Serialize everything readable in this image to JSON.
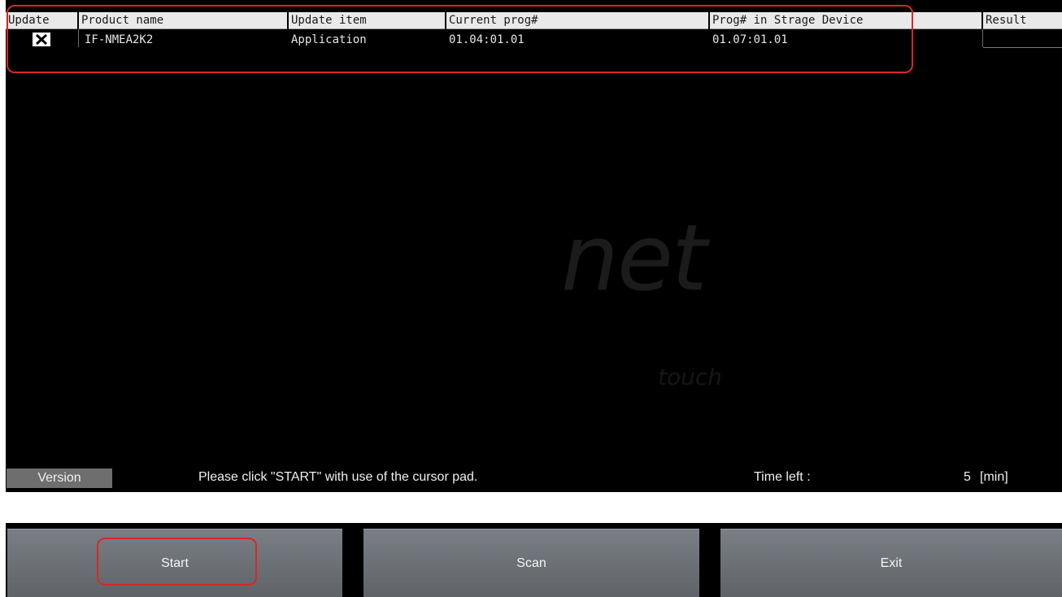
{
  "table": {
    "headers": [
      "Update",
      "Product name",
      "Update item",
      "Current prog#",
      "Prog# in Strage Device",
      "Result"
    ],
    "rows": [
      {
        "update_checked": true,
        "product_name": "IF-NMEA2K2",
        "update_item": "Application",
        "current_prog": "01.04:01.01",
        "storage_prog": "01.07:01.01",
        "result": ""
      }
    ]
  },
  "logo": {
    "main": "net",
    "sub": "touch"
  },
  "status": {
    "version_label": "Version",
    "message": "Please click \"START\" with use of the cursor pad.",
    "time_left_label": "Time left :",
    "time_left_value": "5",
    "time_left_unit": "[min]"
  },
  "message_field": {
    "value": ""
  },
  "buttons": {
    "start": "Start",
    "scan": "Scan",
    "exit": "Exit"
  },
  "colors": {
    "highlight": "#d62828",
    "background": "#000000",
    "button": "#6b7075"
  }
}
